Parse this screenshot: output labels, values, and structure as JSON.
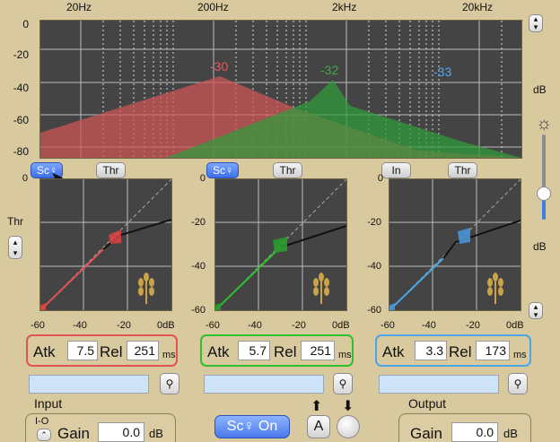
{
  "spectrum": {
    "freq_labels": [
      "20Hz",
      "200Hz",
      "2kHz",
      "20kHz"
    ],
    "db_labels": [
      "0",
      "-20",
      "-40",
      "-60",
      "-80"
    ],
    "unit": "dB",
    "band_values": [
      {
        "text": "-30",
        "color": "#e65a5a"
      },
      {
        "text": "-32",
        "color": "#3caf3c"
      },
      {
        "text": "-33",
        "color": "#4aa6ff"
      }
    ]
  },
  "right_controls": {
    "unit": "dB",
    "brightness_icon": "sun-icon"
  },
  "left_controls": {
    "thr_label": "Thr"
  },
  "bands": [
    {
      "sc_label": "Sc♀",
      "thr_label": "Thr",
      "color": "#e35353",
      "atk_label": "Atk",
      "atk": "7.5",
      "rel_label": "Rel",
      "rel": "251",
      "unit": "ms",
      "ticks": [
        "-60",
        "-40",
        "-20",
        "0dB"
      ]
    },
    {
      "sc_label": "Sc♀",
      "thr_label": "Thr",
      "color": "#2cc12c",
      "atk_label": "Atk",
      "atk": "5.7",
      "rel_label": "Rel",
      "rel": "251",
      "unit": "ms",
      "ticks": [
        "-60",
        "-40",
        "-20",
        "0dB"
      ]
    },
    {
      "sc_label": "In",
      "thr_label": "Thr",
      "color": "#4aa6e6",
      "atk_label": "Atk",
      "atk": "3.3",
      "rel_label": "Rel",
      "rel": "173",
      "unit": "ms",
      "ticks": [
        "-60",
        "-40",
        "-20",
        "0dB"
      ]
    }
  ],
  "y_ticks": [
    "0",
    "-20",
    "-40",
    "-60"
  ],
  "y_unit": "dB",
  "input": {
    "label": "Input",
    "io_label": "I-O",
    "gain_label": "Gain",
    "gain": "0.0",
    "unit": "dB"
  },
  "output": {
    "label": "Output",
    "gain_label": "Gain",
    "gain": "0.0",
    "unit": "dB"
  },
  "center": {
    "sc_on_label": "Sc♀ On",
    "a_label": "A"
  }
}
